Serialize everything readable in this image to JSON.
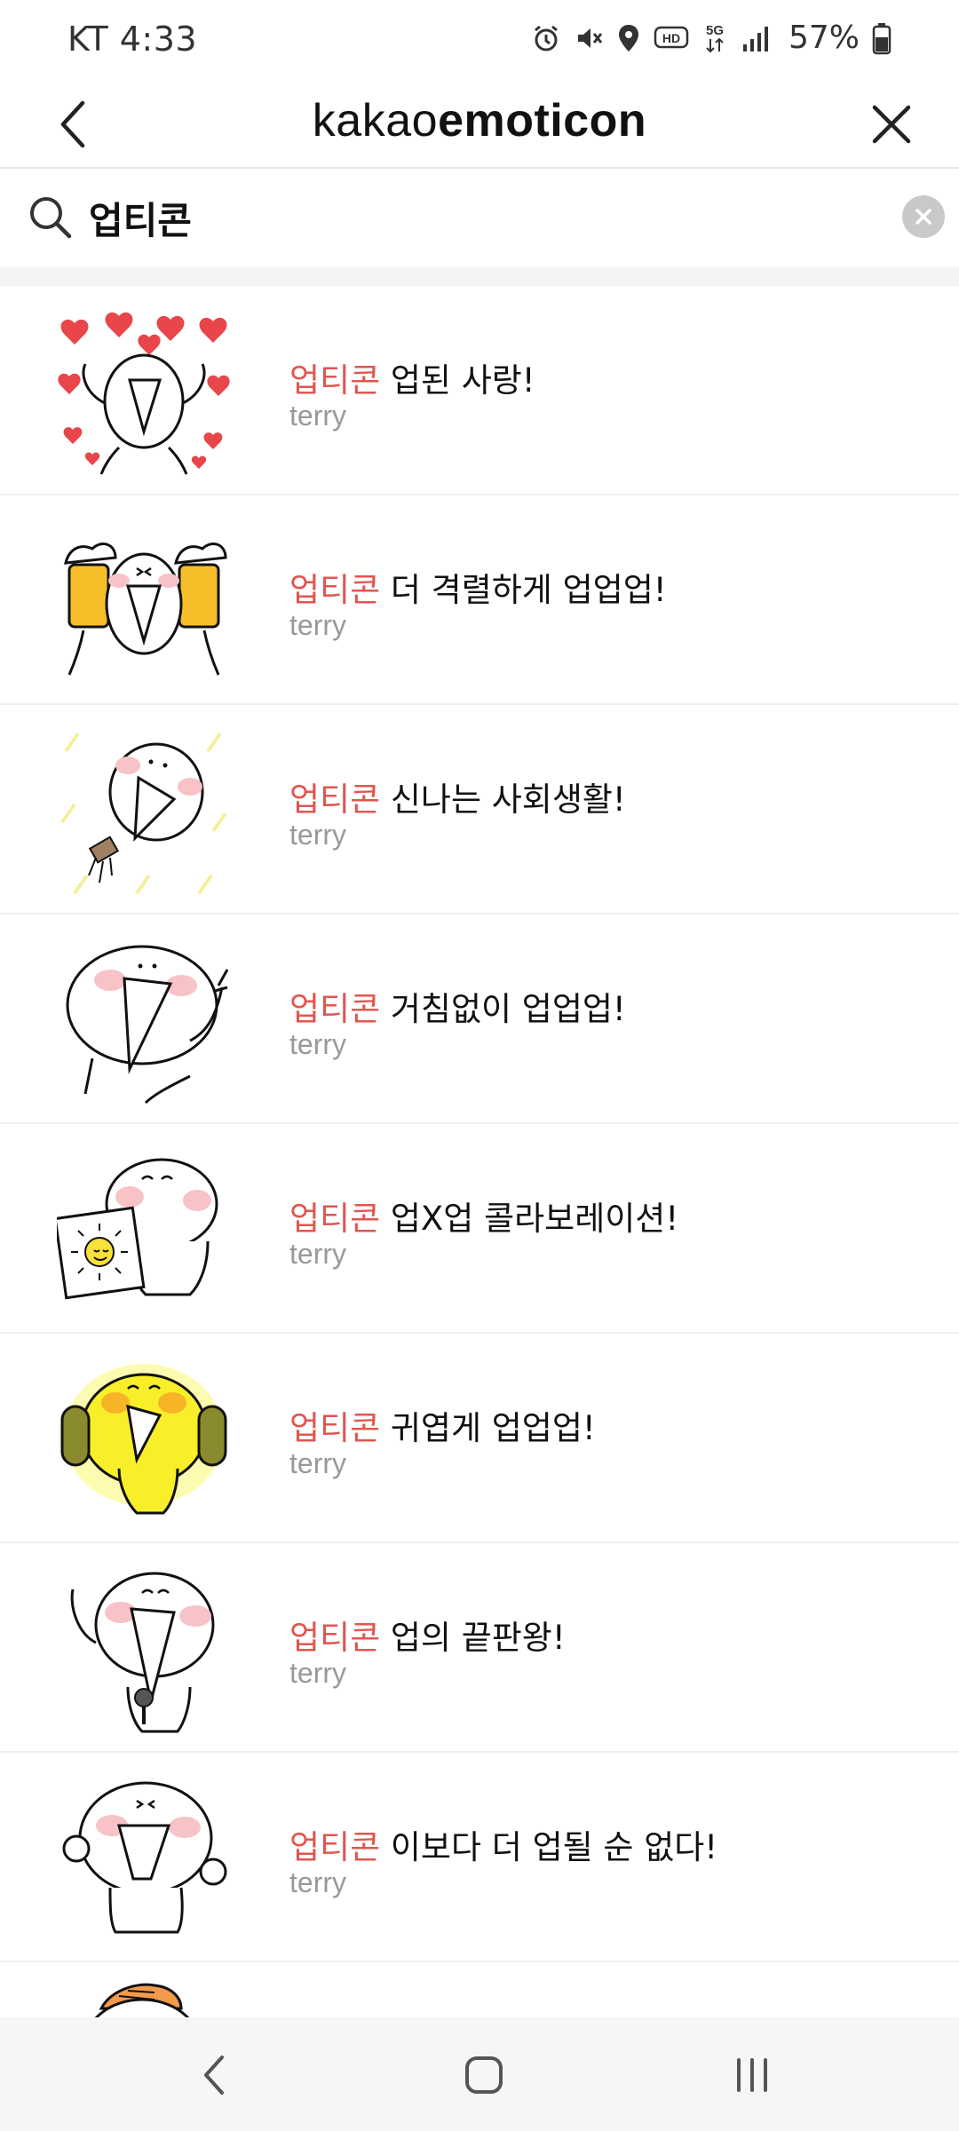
{
  "status_bar": {
    "carrier_time": "KT 4:33",
    "battery_percent": "57%",
    "icons": [
      "alarm-icon",
      "mute-icon",
      "location-icon",
      "hd-icon",
      "5g-icon",
      "signal-icon",
      "battery-icon"
    ]
  },
  "header": {
    "brand_light": "kakao",
    "brand_bold": "emoticon",
    "icons": [
      "back-arrow-icon",
      "close-icon"
    ]
  },
  "search": {
    "value": "업티콘",
    "icons": [
      "search-icon",
      "clear-icon"
    ]
  },
  "colors": {
    "keyword": "#e0564f",
    "author": "#999999",
    "divider": "#f3f4f6"
  },
  "results": [
    {
      "keyword": "업티콘",
      "title": " 업된 사랑!",
      "author": "terry"
    },
    {
      "keyword": "업티콘",
      "title": " 더 격렬하게 업업업!",
      "author": "terry"
    },
    {
      "keyword": "업티콘",
      "title": " 신나는 사회생활!",
      "author": "terry"
    },
    {
      "keyword": "업티콘",
      "title": " 거침없이 업업업!",
      "author": "terry"
    },
    {
      "keyword": "업티콘",
      "title": " 업X업 콜라보레이션!",
      "author": "terry"
    },
    {
      "keyword": "업티콘",
      "title": " 귀엽게 업업업!",
      "author": "terry"
    },
    {
      "keyword": "업티콘",
      "title": " 업의 끝판왕!",
      "author": "terry"
    },
    {
      "keyword": "업티콘",
      "title": " 이보다 더 업될 순 없다!",
      "author": "terry"
    }
  ],
  "nav_bar": {
    "icons": [
      "nav-back-icon",
      "home-icon",
      "recent-apps-icon"
    ]
  }
}
